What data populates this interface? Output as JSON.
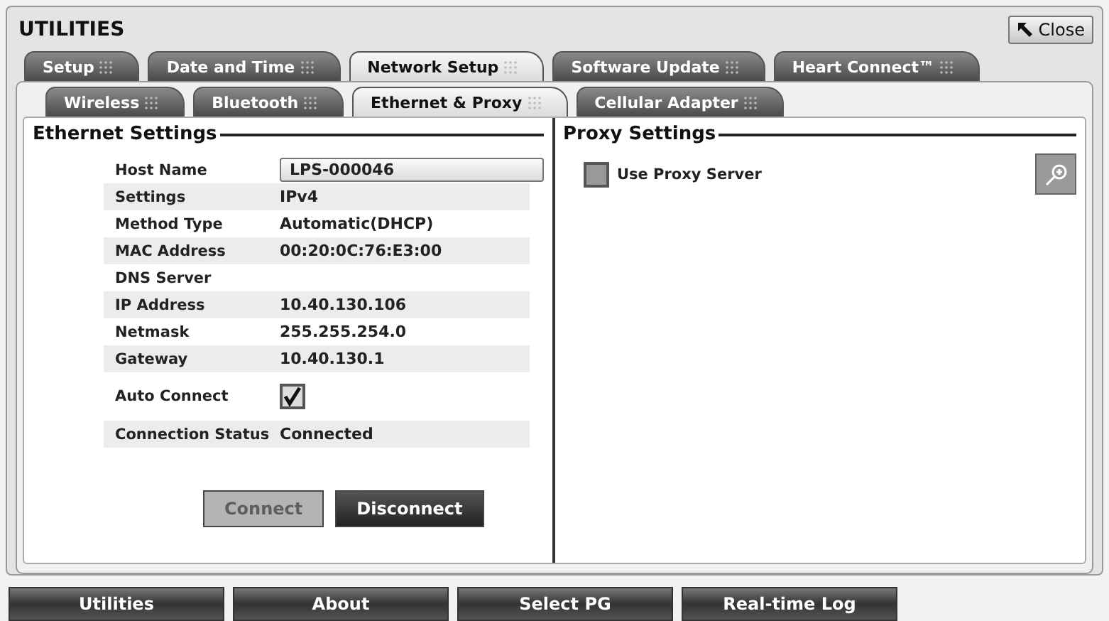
{
  "window": {
    "title": "UTILITIES",
    "close_label": "Close"
  },
  "tabs": [
    {
      "label": "Setup",
      "selected": false
    },
    {
      "label": "Date and Time",
      "selected": false
    },
    {
      "label": "Network Setup",
      "selected": true
    },
    {
      "label": "Software Update",
      "selected": false
    },
    {
      "label": "Heart Connect™",
      "selected": false
    }
  ],
  "subtabs": [
    {
      "label": "Wireless",
      "selected": false
    },
    {
      "label": "Bluetooth",
      "selected": false
    },
    {
      "label": "Ethernet & Proxy",
      "selected": true
    },
    {
      "label": "Cellular Adapter",
      "selected": false
    }
  ],
  "ethernet": {
    "title": "Ethernet Settings",
    "rows": [
      {
        "kind": "field",
        "label": "Host Name",
        "value": "LPS-000046"
      },
      {
        "kind": "text",
        "label": "Settings",
        "value": "IPv4"
      },
      {
        "kind": "text",
        "label": "Method Type",
        "value": "Automatic(DHCP)"
      },
      {
        "kind": "text",
        "label": "MAC Address",
        "value": "00:20:0C:76:E3:00"
      },
      {
        "kind": "text",
        "label": "DNS Server"
      },
      {
        "kind": "text",
        "label": "IP Address",
        "value": "10.40.130.106"
      },
      {
        "kind": "text",
        "label": "Netmask",
        "value": "255.255.254.0"
      },
      {
        "kind": "text",
        "label": "Gateway",
        "value": "10.40.130.1"
      },
      {
        "kind": "checkbox",
        "label": "Auto Connect",
        "checked": true
      },
      {
        "kind": "text",
        "label": "Connection Status",
        "value": "Connected"
      }
    ],
    "buttons": [
      {
        "label": "Connect",
        "disabled": true
      },
      {
        "label": "Disconnect",
        "disabled": false
      }
    ]
  },
  "proxy": {
    "title": "Proxy Settings",
    "use_proxy": {
      "label": "Use Proxy Server",
      "checked": false
    },
    "zoom_disabled": true
  },
  "bottom_buttons": [
    "Utilities",
    "About",
    "Select PG",
    "Real-time Log"
  ]
}
